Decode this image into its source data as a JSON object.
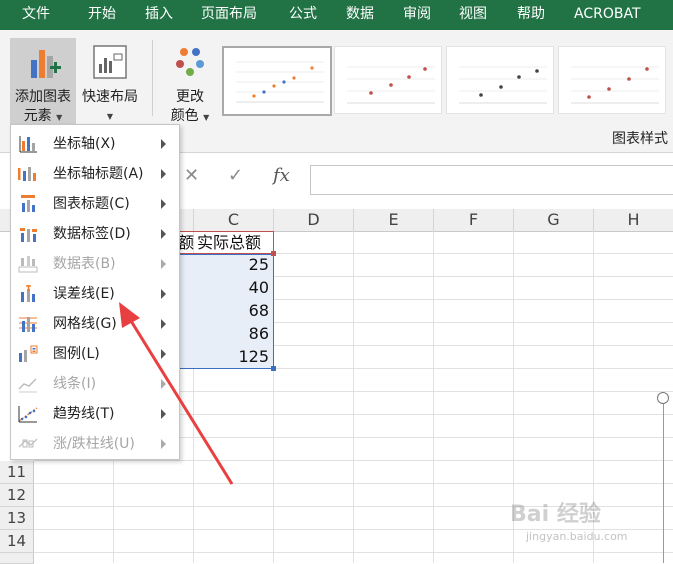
{
  "ribbon_tabs": [
    "文件",
    "开始",
    "插入",
    "页面布局",
    "公式",
    "数据",
    "审阅",
    "视图",
    "帮助",
    "ACROBAT"
  ],
  "ribbon": {
    "add_element": {
      "line1": "添加图表",
      "line2": "元素"
    },
    "quick_layout": {
      "line1": "快速布局"
    },
    "change_colors": {
      "line1": "更改",
      "line2": "颜色"
    },
    "group_label": "图表样式"
  },
  "formula_bar": {
    "cancel": "✕",
    "confirm": "✓",
    "fx": "fx",
    "value": ""
  },
  "columns": [
    "C",
    "D",
    "E",
    "F",
    "G",
    "H"
  ],
  "rows": [
    "11",
    "12",
    "13",
    "14"
  ],
  "cells": {
    "b_header_partial": "额",
    "c_header": "实际总额",
    "c_values": [
      "25",
      "40",
      "68",
      "86",
      "125"
    ]
  },
  "menu": {
    "items": [
      {
        "label": "坐标轴(X)",
        "icon": "axes-icon",
        "disabled": false
      },
      {
        "label": "坐标轴标题(A)",
        "icon": "axis-titles-icon",
        "disabled": false
      },
      {
        "label": "图表标题(C)",
        "icon": "chart-title-icon",
        "disabled": false
      },
      {
        "label": "数据标签(D)",
        "icon": "data-labels-icon",
        "disabled": false
      },
      {
        "label": "数据表(B)",
        "icon": "data-table-icon",
        "disabled": true
      },
      {
        "label": "误差线(E)",
        "icon": "error-bars-icon",
        "disabled": false
      },
      {
        "label": "网格线(G)",
        "icon": "gridlines-icon",
        "disabled": false
      },
      {
        "label": "图例(L)",
        "icon": "legend-icon",
        "disabled": false
      },
      {
        "label": "线条(I)",
        "icon": "lines-icon",
        "disabled": true
      },
      {
        "label": "趋势线(T)",
        "icon": "trendline-icon",
        "disabled": false
      },
      {
        "label": "涨/跌柱线(U)",
        "icon": "up-down-bars-icon",
        "disabled": true
      }
    ]
  },
  "watermark": {
    "main": "Bai 经验",
    "sub": "jingyan.baidu.com"
  },
  "colors": {
    "accent": "#217346",
    "arrow": "#e84040",
    "selection": "#3b6fbf"
  }
}
